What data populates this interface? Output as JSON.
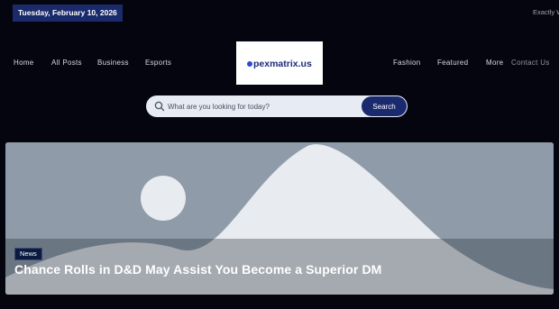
{
  "topbar": {
    "date": "Tuesday, February 10, 2026",
    "ticker": "Exactly W"
  },
  "nav": {
    "left": [
      "Home",
      "All Posts",
      "Business",
      "Esports"
    ],
    "right": [
      "Fashion",
      "Featured",
      "More"
    ],
    "contact": "Contact Us"
  },
  "logo": {
    "text": "pexmatrix.us"
  },
  "search": {
    "placeholder": "What are you looking for today?",
    "button_label": "Search"
  },
  "hero": {
    "category": "News",
    "title": "Chance Rolls in D&D May Assist You Become a Superior DM"
  },
  "colors": {
    "background": "#05050f",
    "accent": "#1b2a6e",
    "hero_bg": "#8f9ba8"
  }
}
